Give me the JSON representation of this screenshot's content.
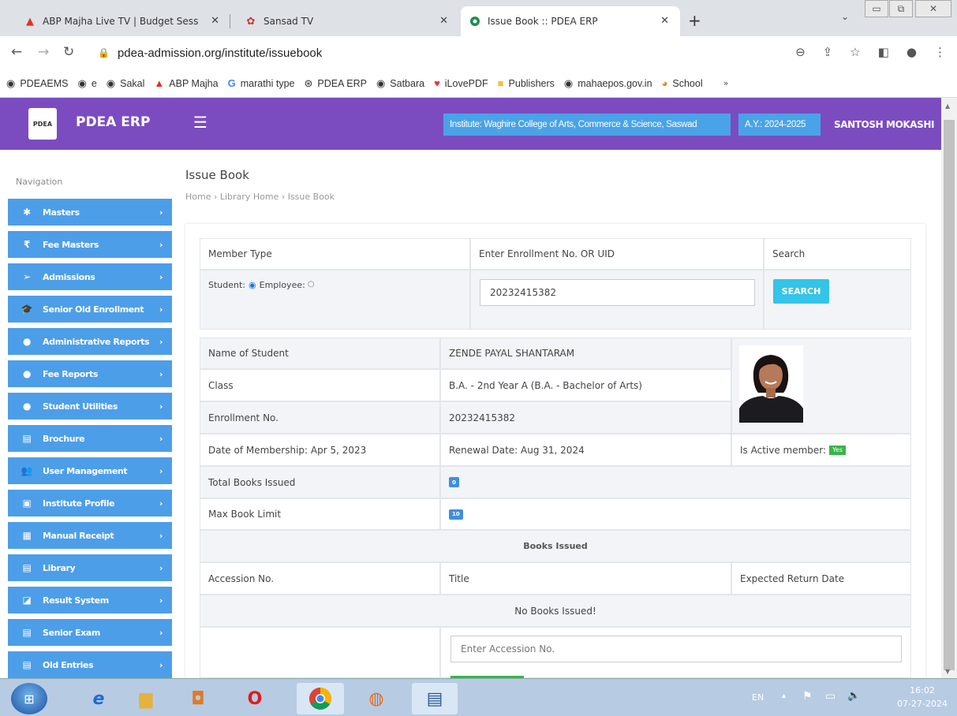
{
  "browser": {
    "tabs": [
      {
        "title": "ABP Majha Live TV | Budget Sess",
        "icon": "abp-icon"
      },
      {
        "title": "Sansad TV",
        "icon": "sansad-icon"
      },
      {
        "title": "Issue Book :: PDEA ERP",
        "icon": "pdea-erp-icon"
      }
    ],
    "url": "pdea-admission.org/institute/issuebook",
    "bookmarks": [
      "PDEAEMS",
      "e",
      "Sakal",
      "ABP Majha",
      "marathi type",
      "PDEA ERP",
      "Satbara",
      "iLovePDF",
      "Publishers",
      "mahaepos.gov.in",
      "School"
    ]
  },
  "header": {
    "brand": "PDEA ERP",
    "logo_text": "PDEA",
    "institute": "Institute: Waghire College of Arts, Commerce & Science, Saswad",
    "academic_year": "A.Y.: 2024-2025",
    "user": "SANTOSH MOKASHI"
  },
  "sidebar": {
    "title": "Navigation",
    "items": [
      {
        "label": "Masters",
        "icon": "asterisk-icon"
      },
      {
        "label": "Fee Masters",
        "icon": "rupee-icon"
      },
      {
        "label": "Admissions",
        "icon": "user-arrow-icon"
      },
      {
        "label": "Senior Old Enrollment",
        "icon": "graduation-cap-icon"
      },
      {
        "label": "Administrative Reports",
        "icon": "circle-icon"
      },
      {
        "label": "Fee Reports",
        "icon": "circle-icon"
      },
      {
        "label": "Student Utilities",
        "icon": "circle-icon"
      },
      {
        "label": "Brochure",
        "icon": "document-icon"
      },
      {
        "label": "User Management",
        "icon": "users-icon"
      },
      {
        "label": "Institute Profile",
        "icon": "id-card-icon"
      },
      {
        "label": "Manual Receipt",
        "icon": "receipt-icon"
      },
      {
        "label": "Library",
        "icon": "book-icon"
      },
      {
        "label": "Result System",
        "icon": "result-icon"
      },
      {
        "label": "Senior Exam",
        "icon": "document-icon"
      },
      {
        "label": "Old Entries",
        "icon": "document-icon"
      }
    ]
  },
  "page": {
    "title": "Issue Book",
    "breadcrumb": "Home  ›  Library Home  ›  Issue Book"
  },
  "search": {
    "col_member_type": "Member Type",
    "col_enroll": "Enter Enrollment No. OR UID",
    "col_search": "Search",
    "student_label": "Student:",
    "employee_label": "Employee:",
    "enroll_value": "20232415382",
    "button": "SEARCH"
  },
  "student": {
    "name_label": "Name of Student",
    "name": "ZENDE PAYAL SHANTARAM",
    "class_label": "Class",
    "class": "B.A. - 2nd Year A (B.A. - Bachelor of Arts)",
    "enroll_label": "Enrollment No.",
    "enroll": "20232415382",
    "membership": "Date of Membership: Apr 5, 2023",
    "renewal": "Renewal Date: Aug 31, 2024",
    "active_label": "Is Active member:",
    "active": "Yes",
    "total_label": "Total Books Issued",
    "total": "0",
    "max_label": "Max Book Limit",
    "max": "10"
  },
  "books": {
    "heading": "Books Issued",
    "col_accession": "Accession No.",
    "col_title": "Title",
    "col_return": "Expected Return Date",
    "empty": "No Books Issued!",
    "accession_placeholder": "Enter Accession No."
  },
  "taskbar": {
    "lang": "EN",
    "time": "16:02",
    "date": "07-27-2024"
  }
}
